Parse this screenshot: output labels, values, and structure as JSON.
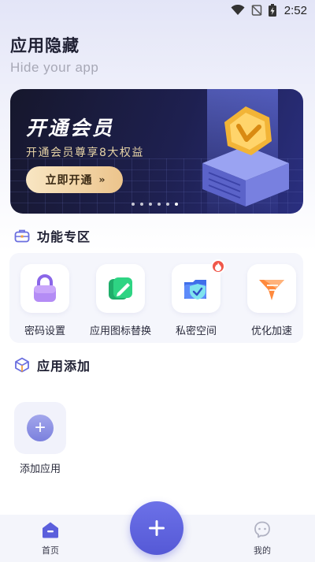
{
  "status_bar": {
    "time": "2:52"
  },
  "header": {
    "title": "应用隐藏",
    "subtitle": "Hide your app"
  },
  "banner": {
    "title": "开通会员",
    "subtitle": "开通会员尊享8大权益",
    "button_label": "立即开通",
    "button_chevrons": "››",
    "slide_count": 6,
    "active_slide": 6
  },
  "features_section": {
    "title": "功能专区",
    "items": [
      {
        "label": "密码设置",
        "icon": "lock-icon"
      },
      {
        "label": "应用图标替换",
        "icon": "pencil-card-icon"
      },
      {
        "label": "私密空间",
        "icon": "shield-folder-icon",
        "badge": "fire-icon"
      },
      {
        "label": "优化加速",
        "icon": "funnel-speed-icon"
      }
    ]
  },
  "apps_section": {
    "title": "应用添加",
    "add_label": "添加应用",
    "add_symbol": "+"
  },
  "bottom_nav": {
    "items": [
      {
        "label": "首页",
        "icon": "home-icon",
        "active": true
      },
      {
        "label": "我的",
        "icon": "profile-icon",
        "active": false
      }
    ],
    "fab_icon": "plus-icon"
  },
  "colors": {
    "accent": "#5b5fdc",
    "banner_gold": "#ecc48c",
    "badge_red": "#f0574a"
  }
}
